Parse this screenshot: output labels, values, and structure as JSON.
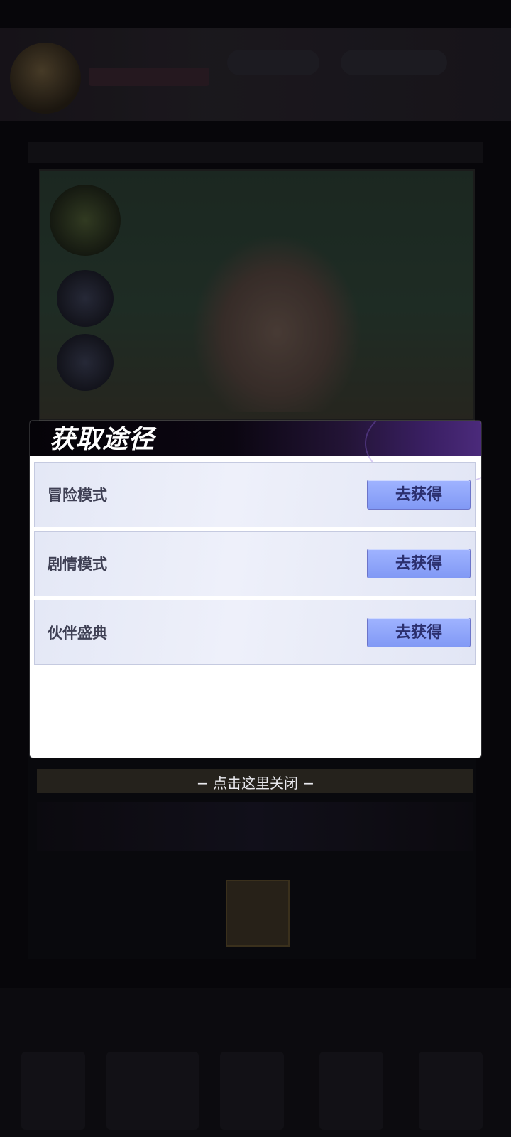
{
  "dialog": {
    "title": "获取途径",
    "rows": [
      {
        "label": "冒险模式",
        "button": "去获得"
      },
      {
        "label": "剧情模式",
        "button": "去获得"
      },
      {
        "label": "伙伴盛典",
        "button": "去获得"
      }
    ]
  },
  "close_hint": {
    "dash_left": "−",
    "text": "点击这里关闭",
    "dash_right": "−"
  },
  "colors": {
    "accent_button": "#8da3fb",
    "header_purple": "#4b2a7b",
    "row_background": "#e8ebf7"
  }
}
